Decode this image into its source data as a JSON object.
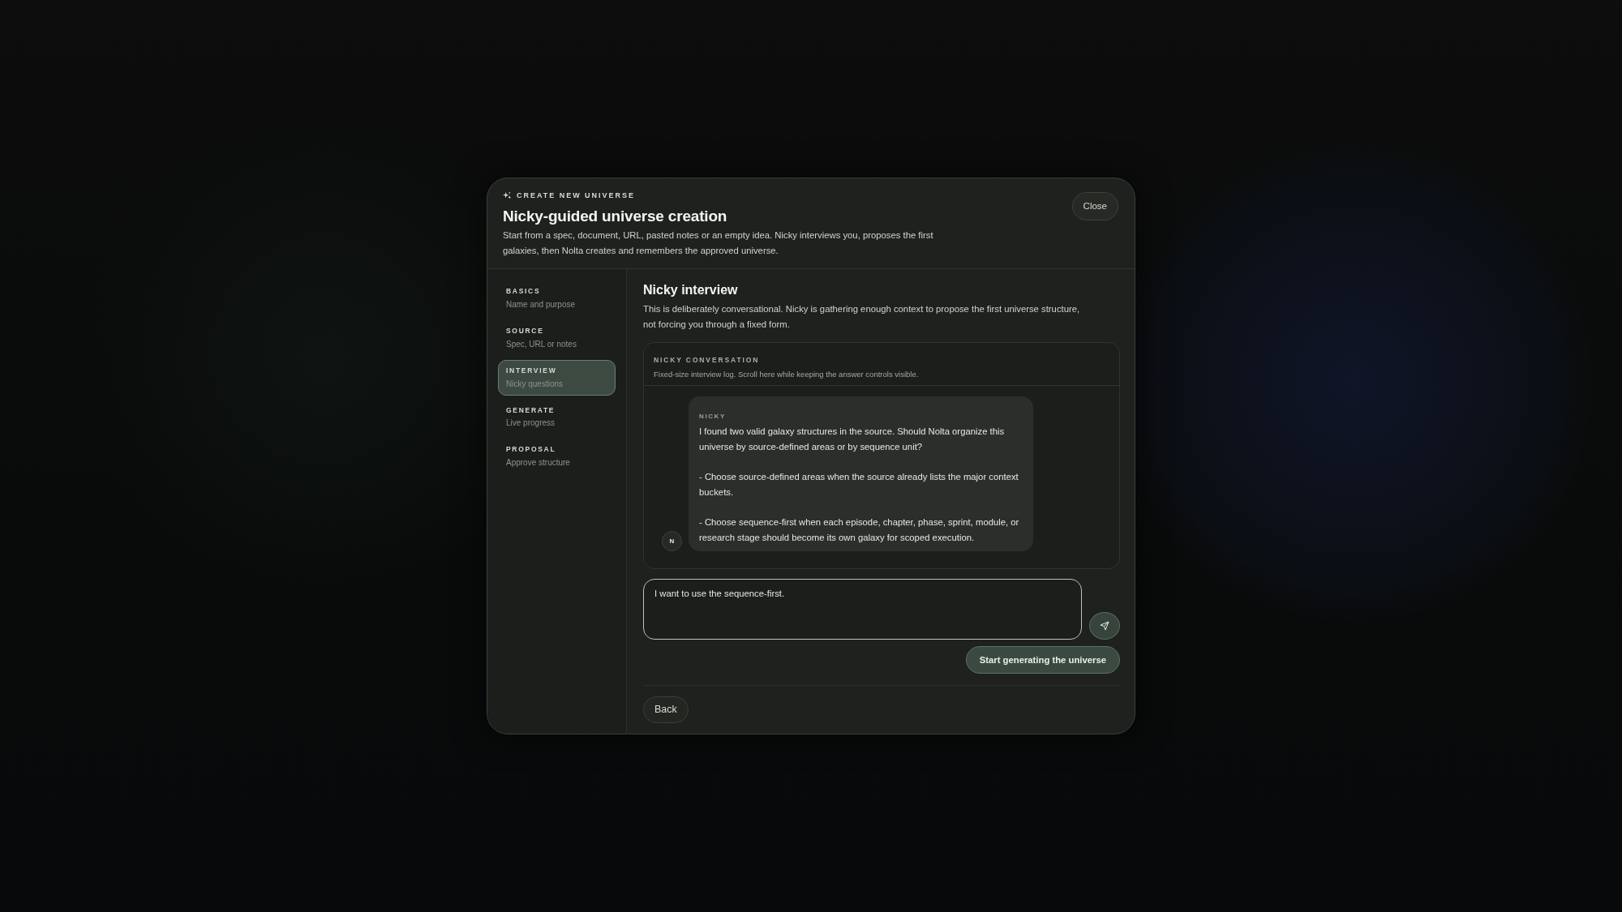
{
  "dialog": {
    "eyebrow": "CREATE NEW UNIVERSE",
    "title": "Nicky-guided universe creation",
    "description": "Start from a spec, document, URL, pasted notes or an empty idea. Nicky interviews you, proposes the first galaxies, then Nolta creates and remembers the approved universe.",
    "close_button": "Close"
  },
  "steps": [
    {
      "label": "BASICS",
      "sublabel": "Name and purpose",
      "selected": false
    },
    {
      "label": "SOURCE",
      "sublabel": "Spec, URL or notes",
      "selected": false
    },
    {
      "label": "INTERVIEW",
      "sublabel": "Nicky questions",
      "selected": true
    },
    {
      "label": "GENERATE",
      "sublabel": "Live progress",
      "selected": false
    },
    {
      "label": "PROPOSAL",
      "sublabel": "Approve structure",
      "selected": false
    }
  ],
  "section": {
    "title": "Nicky interview",
    "description": "This is deliberately conversational. Nicky is gathering enough context to propose the first universe structure, not forcing you through a fixed form."
  },
  "conversation": {
    "title": "NICKY CONVERSATION",
    "subtitle": "Fixed-size interview log. Scroll here while keeping the answer controls visible.",
    "messages": [
      {
        "author": "NICKY",
        "avatar": "N",
        "paragraphs": [
          "I found two valid galaxy structures in the source. Should Nolta organize this universe by source-defined areas or by sequence unit?",
          "- Choose source-defined areas when the source already lists the major context buckets.",
          "- Choose sequence-first when each episode, chapter, phase, sprint, module, or research stage should become its own galaxy for scoped execution."
        ]
      }
    ]
  },
  "answer": {
    "value": "I want to use the sequence-first."
  },
  "start_button": "Start generating the universe",
  "back_button": "Back"
}
